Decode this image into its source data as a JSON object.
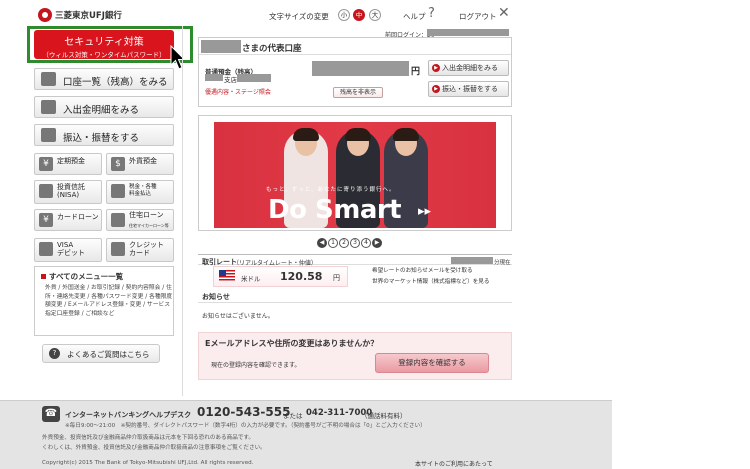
{
  "header": {
    "bank_name": "三菱東京UFJ銀行",
    "fontsize_label": "文字サイズの変更",
    "fontsize_small": "小",
    "fontsize_medium": "中",
    "fontsize_large": "大",
    "help": "ヘルプ",
    "help_icon": "?",
    "logout": "ログアウト",
    "close_icon": "✕"
  },
  "sidebar": {
    "security_title": "セキュリティ対策",
    "security_sub": "（ウィルス対策・ワンタイムパスワード）",
    "big_items": [
      {
        "label": "口座一覧（残高）をみる"
      },
      {
        "label": "入出金明細をみる"
      },
      {
        "label": "振込・振替をする"
      }
    ],
    "small_items": [
      {
        "icon": "¥",
        "label": "定期預金"
      },
      {
        "icon": "$",
        "label": "外貨預金"
      },
      {
        "icon": "",
        "label": "投資信託\n(NISA)"
      },
      {
        "icon": "",
        "label": "税金・各種\n料金払込"
      },
      {
        "icon": "¥",
        "label": "カードローン"
      },
      {
        "icon": "",
        "label": "住宅ローン"
      },
      {
        "icon": "",
        "label": "VISA\nデビット"
      },
      {
        "icon": "",
        "label": "クレジット\nカード"
      }
    ],
    "housing_sub": "住宅マイカーローン等",
    "menu_title": "すべてのメニュー一覧",
    "menu_text": "外貨 / 外国送金 / お取引記録 / 契約内容照会 / 住所・連絡先変更 / 各種パスワード変更 / 各種限度額変更 / Eメールアドレス登録・変更 / サービス指定口座登録 / ご相談など",
    "faq": "よくあるご質問はこちら",
    "faq_icon": "?"
  },
  "account": {
    "last_login": "前回ログイン：20",
    "title_suffix": "さまの代表口座",
    "type": "普通預金（残高）",
    "branch_suffix": "支店",
    "balance_unit": "円",
    "service_link": "優遇内容・ステージ照会",
    "hide_balance": "残高を非表示",
    "btn_statement": "入出金明細をみる",
    "btn_transfer": "振込・振替をする"
  },
  "banner": {
    "copy": "もっと、ずっと、あなたに寄り添う銀行へ。",
    "logo": "Do Smart",
    "arrow": "▸▸"
  },
  "pager": {
    "prev": "◀",
    "pages": [
      "1",
      "2",
      "3",
      "4"
    ],
    "next": "▶"
  },
  "rates": {
    "title": "取引レート",
    "subtitle": "（リアルタイムレート・仲値）",
    "time_label": "分現在",
    "currency": "米ドル",
    "value": "120.58",
    "unit": "円",
    "link1": "希望レートのお知らせメールを受け取る",
    "link2": "世界のマーケット情報（株式指標など）を見る"
  },
  "notice": {
    "title": "お知らせ",
    "text": "お知らせはございません。"
  },
  "email": {
    "title": "Eメールアドレスや住所の変更はありませんか？",
    "text": "現在の登録内容を確認できます。",
    "button": "登録内容を確認する"
  },
  "footer": {
    "helpdesk_label": "インターネットバンキングヘルプデスク",
    "phone": "0120-543-555",
    "or": "または",
    "phone2": "042-311-7000",
    "note": "（通話料有料）",
    "hours": "※毎日9:00～21:00　※契約番号、ダイレクトパスワード（数字4桁）の入力が必要です。（契約番号がご不明の場合は「0」とご入力ください）",
    "disclaimer1": "外貨預金、投資信託及び金融商品仲介取扱商品は元本を下回る恐れのある商品です。",
    "disclaimer2": "くわしくは、外貨預金、投資信託及び金融商品仲介取扱商品の注意事項をご覧ください。",
    "copyright": "Copyright(c) 2015 The Bank of Tokyo-Mitsubishi UFJ,Ltd. All rights reserved.",
    "terms": "本サイトのご利用にあたって"
  }
}
